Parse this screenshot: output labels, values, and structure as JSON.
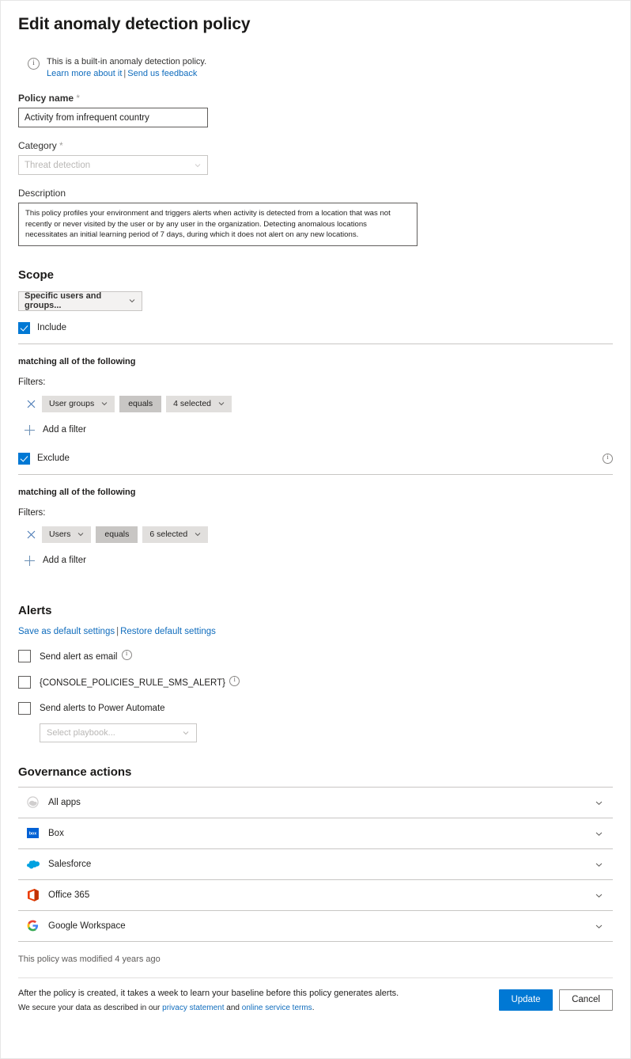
{
  "page": {
    "title": "Edit anomaly detection policy"
  },
  "banner": {
    "icon": "info-icon",
    "text": "This is a built-in anomaly detection policy.",
    "learn_more": "Learn more about it",
    "separator": "|",
    "feedback": "Send us feedback"
  },
  "policy_name": {
    "label": "Policy name",
    "required_mark": "*",
    "value": "Activity from infrequent country"
  },
  "category": {
    "label": "Category",
    "required_mark": "*",
    "value": "Threat detection"
  },
  "description": {
    "label": "Description",
    "value": "This policy profiles your environment and triggers alerts when activity is detected from a location that was not recently or never visited by the user or by any user in the organization. Detecting anomalous locations necessitates an initial learning period of 7 days, during which it does not alert on any new locations."
  },
  "scope": {
    "heading": "Scope",
    "selector_value": "Specific users and groups...",
    "include": {
      "label": "Include",
      "checked": true,
      "matching": "matching all of the following",
      "filters_label": "Filters:",
      "filter": {
        "field": "User groups",
        "operator": "equals",
        "value": "4 selected"
      },
      "add_filter": "Add a filter"
    },
    "exclude": {
      "label": "Exclude",
      "checked": true,
      "info_icon": "info-icon",
      "matching": "matching all of the following",
      "filters_label": "Filters:",
      "filter": {
        "field": "Users",
        "operator": "equals",
        "value": "6 selected"
      },
      "add_filter": "Add a filter"
    }
  },
  "alerts": {
    "heading": "Alerts",
    "save_default": "Save as default settings",
    "separator": "|",
    "restore_default": "Restore default settings",
    "options": [
      {
        "label": "Send alert as email",
        "checked": false,
        "has_info": true
      },
      {
        "label": "{CONSOLE_POLICIES_RULE_SMS_ALERT}",
        "checked": false,
        "has_info": true
      },
      {
        "label": "Send alerts to Power Automate",
        "checked": false,
        "has_info": false
      }
    ],
    "playbook_placeholder": "Select playbook..."
  },
  "governance": {
    "heading": "Governance actions",
    "rows": [
      {
        "label": "All apps",
        "icon": "all-apps-icon"
      },
      {
        "label": "Box",
        "icon": "box-icon"
      },
      {
        "label": "Salesforce",
        "icon": "salesforce-icon"
      },
      {
        "label": "Office 365",
        "icon": "office365-icon"
      },
      {
        "label": "Google Workspace",
        "icon": "google-workspace-icon"
      }
    ]
  },
  "footer": {
    "modified": "This policy was modified 4 years ago",
    "note": "After the policy is created, it takes a week to learn your baseline before this policy generates alerts.",
    "secure_prefix": "We secure your data as described in our ",
    "privacy_link": "privacy statement",
    "secure_mid": " and ",
    "terms_link": "online service terms",
    "secure_suffix": ".",
    "update_button": "Update",
    "cancel_button": "Cancel"
  },
  "colors": {
    "accent": "#0078d4",
    "link": "#0f6cbd",
    "chip": "#e1dfdd",
    "chip_dark": "#c8c6c4"
  }
}
